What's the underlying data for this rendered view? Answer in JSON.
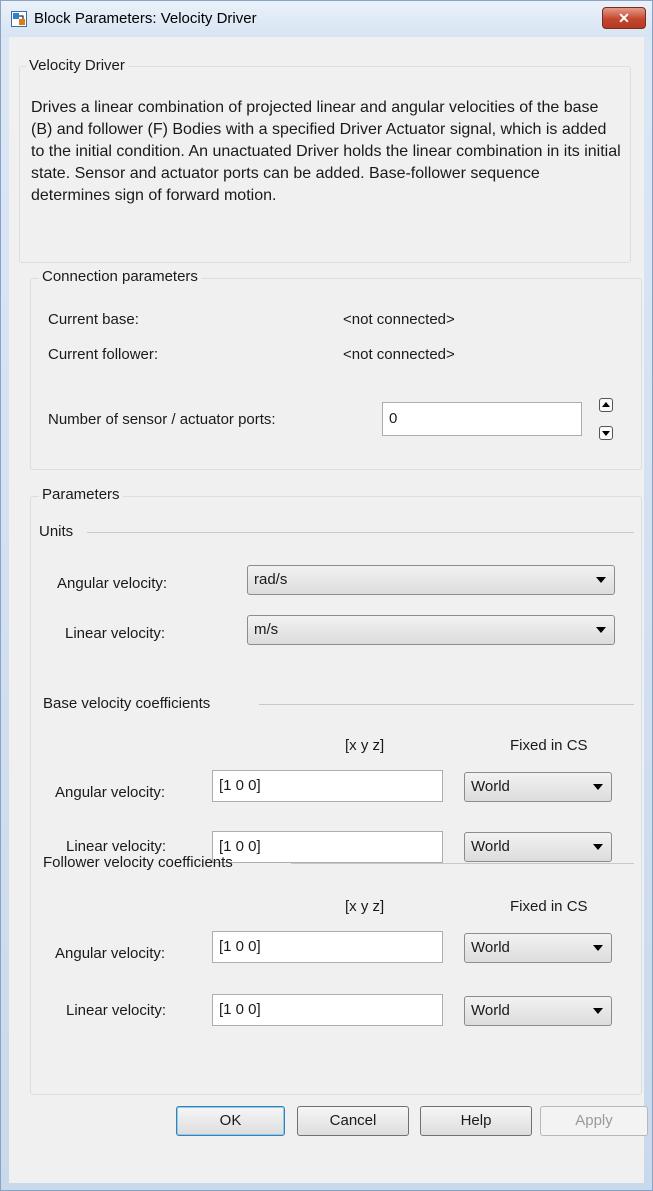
{
  "window": {
    "title": "Block Parameters: Velocity Driver",
    "close_glyph": "✕"
  },
  "description": {
    "group_label": "Velocity Driver",
    "text": "Drives a linear combination of projected linear and angular velocities of the base (B) and follower (F) Bodies with a specified Driver Actuator signal, which is added to the initial condition. An unactuated Driver holds the linear combination in its initial state. Sensor and actuator ports can be added. Base-follower sequence determines sign of forward motion."
  },
  "connection": {
    "group_label": "Connection parameters",
    "current_base_label": "Current base:",
    "current_base_value": "<not connected>",
    "current_follower_label": "Current follower:",
    "current_follower_value": "<not connected>",
    "ports_label": "Number of sensor / actuator ports:",
    "ports_value": "0"
  },
  "parameters": {
    "group_label": "Parameters",
    "units": {
      "label": "Units",
      "angular_label": "Angular velocity:",
      "angular_value": "rad/s",
      "linear_label": "Linear velocity:",
      "linear_value": "m/s"
    },
    "base": {
      "label": "Base velocity coefficients",
      "xyz_header": "[x y z]",
      "cs_header": "Fixed in CS",
      "angular_label": "Angular velocity:",
      "angular_value": "[1 0 0]",
      "angular_cs": "World",
      "linear_label": "Linear velocity:",
      "linear_value": "[1 0 0]",
      "linear_cs": "World"
    },
    "follower": {
      "label": "Follower velocity coefficients",
      "xyz_header": "[x y z]",
      "cs_header": "Fixed in CS",
      "angular_label": "Angular velocity:",
      "angular_value": "[1 0 0]",
      "angular_cs": "World",
      "linear_label": "Linear velocity:",
      "linear_value": "[1 0 0]",
      "linear_cs": "World"
    }
  },
  "buttons": {
    "ok": "OK",
    "cancel": "Cancel",
    "help": "Help",
    "apply": "Apply"
  },
  "colors": {
    "titlebar": "#dbe7f5",
    "client": "#f0f0f0",
    "close": "#c3472f"
  },
  "icons": [
    "simulink-block-icon",
    "close-icon",
    "chevron-down-icon",
    "spin-up-icon",
    "spin-down-icon"
  ]
}
